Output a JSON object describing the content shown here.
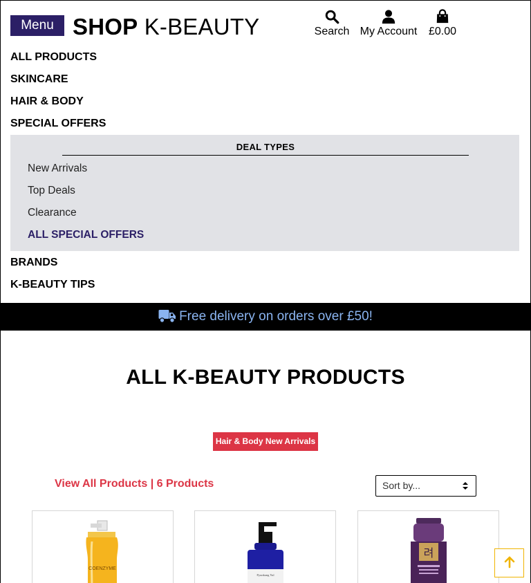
{
  "header": {
    "menu_label": "Menu",
    "brand_bold": "SHOP",
    "brand_rest": " K-BEAUTY",
    "search_label": "Search",
    "account_label": "My Account",
    "bag_total": "£0.00"
  },
  "nav": {
    "items": [
      {
        "label": "ALL PRODUCTS"
      },
      {
        "label": "SKINCARE"
      },
      {
        "label": "HAIR & BODY"
      },
      {
        "label": "SPECIAL OFFERS"
      },
      {
        "label": "BRANDS"
      },
      {
        "label": "K-BEAUTY TIPS"
      }
    ]
  },
  "dropdown": {
    "title": "DEAL TYPES",
    "items": [
      {
        "label": "New Arrivals"
      },
      {
        "label": "Top Deals"
      },
      {
        "label": "Clearance"
      },
      {
        "label": "ALL SPECIAL OFFERS"
      }
    ]
  },
  "delivery": {
    "text": "Free delivery on orders over £50!"
  },
  "main": {
    "title": "ALL K-BEAUTY PRODUCTS",
    "filter_badge": "Hair & Body New Arrivals",
    "view_all": "View All Products | 6 Products",
    "sort_placeholder": "Sort by..."
  },
  "products": [
    {
      "image_text": "COENZYME"
    },
    {
      "image_text": "Pyunkang Yul"
    },
    {
      "image_text": "려"
    }
  ],
  "colors": {
    "brand_purple": "#2b1f66",
    "accent_red": "#dc3545",
    "delivery_text": "#8ab4f0",
    "dropdown_bg": "#e1e2e6",
    "back_to_top_border": "#f0b400"
  }
}
